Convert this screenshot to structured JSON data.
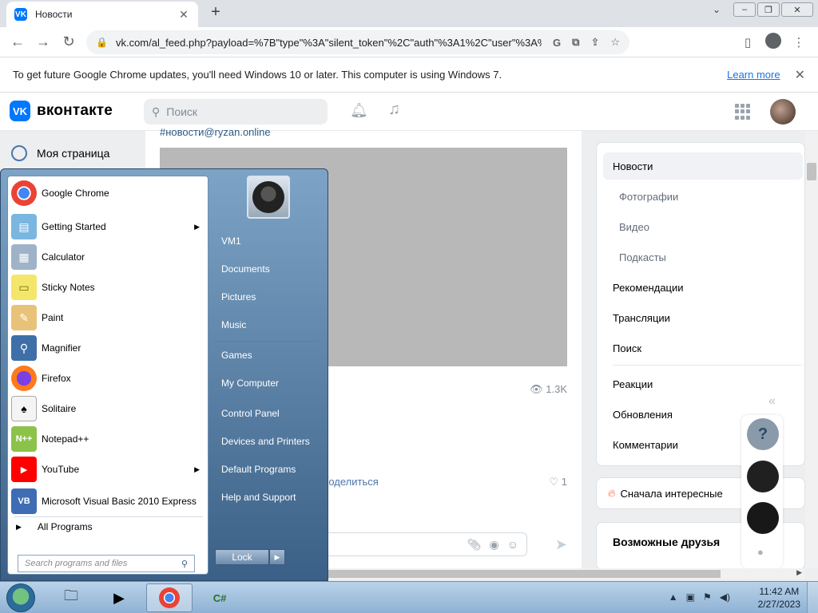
{
  "browser": {
    "tab_title": "Новости",
    "tab_favicon": "VK",
    "url": "vk.com/al_feed.php?payload=%7B\"type\"%3A\"silent_token\"%2C\"auth\"%3A1%2C\"user\"%3A%7B\"id\"%3...",
    "infobar_message": "To get future Google Chrome updates, you'll need Windows 10 or later. This computer is using Windows 7.",
    "infobar_link": "Learn more"
  },
  "vk": {
    "logo_mark": "VK",
    "logo_text": "вконтакте",
    "search_placeholder": "Поиск",
    "my_page": "Моя страница",
    "post": {
      "hashtag": "#новости@ryzan.online",
      "views": "1.3K",
      "share_label": "Поделиться",
      "likes": "1"
    },
    "right_menu": {
      "items": [
        {
          "label": "Новости",
          "active": true
        },
        {
          "label": "Фотографии",
          "sub": true
        },
        {
          "label": "Видео",
          "sub": true
        },
        {
          "label": "Подкасты",
          "sub": true
        },
        {
          "label": "Рекомендации"
        },
        {
          "label": "Трансляции"
        },
        {
          "label": "Поиск"
        },
        {
          "label": "Реакции"
        },
        {
          "label": "Обновления"
        },
        {
          "label": "Комментарии"
        }
      ]
    },
    "sort_label": "Сначала интересные",
    "friends_title": "Возможные друзья"
  },
  "start_menu": {
    "programs": [
      {
        "label": "Google Chrome",
        "icon": "chrome-icon",
        "submenu": false
      },
      {
        "label": "Getting Started",
        "icon": "getting-started-icon",
        "submenu": true
      },
      {
        "label": "Calculator",
        "icon": "calculator-icon",
        "submenu": false
      },
      {
        "label": "Sticky Notes",
        "icon": "sticky-notes-icon",
        "submenu": false
      },
      {
        "label": "Paint",
        "icon": "paint-icon",
        "submenu": false
      },
      {
        "label": "Magnifier",
        "icon": "magnifier-icon",
        "submenu": false
      },
      {
        "label": "Firefox",
        "icon": "firefox-icon",
        "submenu": false
      },
      {
        "label": "Solitaire",
        "icon": "solitaire-icon",
        "submenu": false
      },
      {
        "label": "Notepad++",
        "icon": "notepadpp-icon",
        "submenu": false
      },
      {
        "label": "YouTube",
        "icon": "youtube-icon",
        "submenu": true
      },
      {
        "label": "Microsoft Visual Basic 2010 Express",
        "icon": "vb-icon",
        "submenu": false
      }
    ],
    "all_programs": "All Programs",
    "search_placeholder": "Search programs and files",
    "right_items": [
      "VM1",
      "Documents",
      "Pictures",
      "Music",
      "Games",
      "My Computer",
      "Control Panel",
      "Devices and Printers",
      "Default Programs",
      "Help and Support"
    ],
    "lock_label": "Lock"
  },
  "taskbar": {
    "time": "11:42 AM",
    "date": "2/27/2023"
  }
}
